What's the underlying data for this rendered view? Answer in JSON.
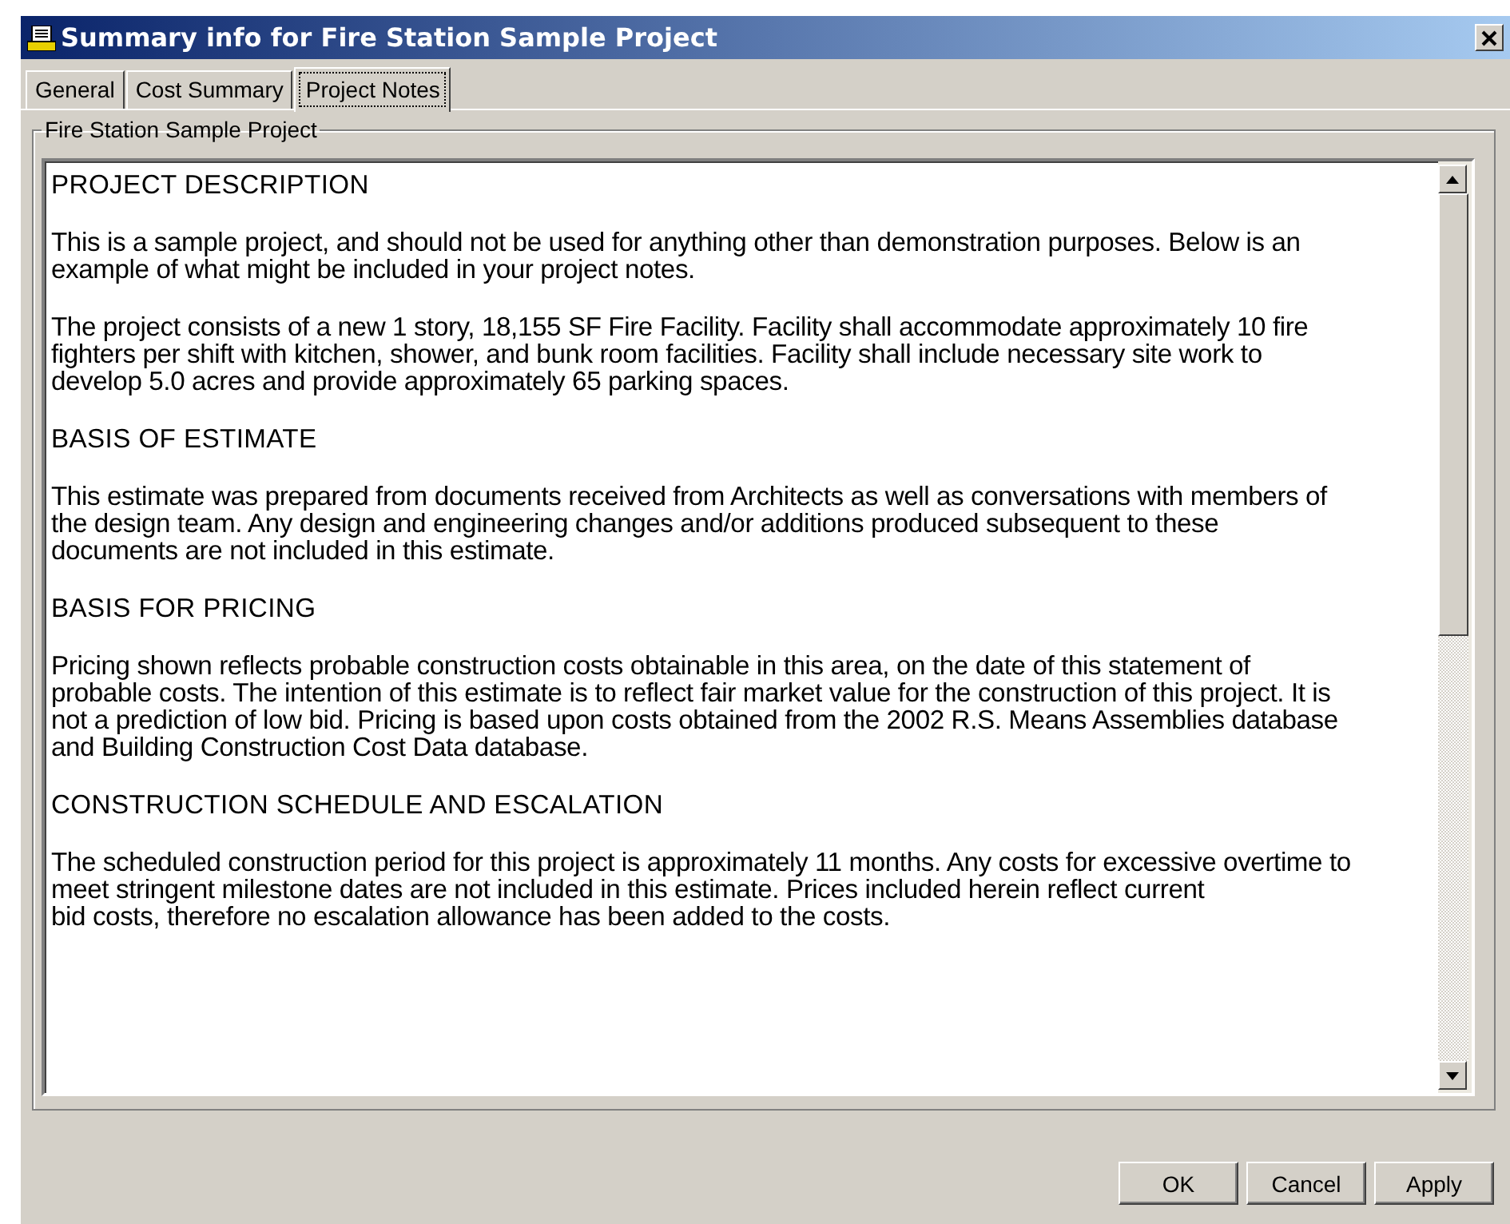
{
  "window": {
    "title": "Summary info for Fire Station Sample Project"
  },
  "tabs": [
    {
      "label": "General",
      "selected": false
    },
    {
      "label": "Cost Summary",
      "selected": false
    },
    {
      "label": "Project Notes",
      "selected": true
    }
  ],
  "group": {
    "label": "Fire Station Sample Project"
  },
  "notes": [
    {
      "kind": "heading",
      "text": "PROJECT DESCRIPTION"
    },
    {
      "kind": "body",
      "text": "This is a sample project, and should not be used for anything other than demonstration purposes.  Below is an\nexample of what might be included in your project notes."
    },
    {
      "kind": "body",
      "text": "The project consists of a new 1 story, 18,155 SF Fire Facility.  Facility shall accommodate approximately 10 fire\nfighters per shift with kitchen, shower, and bunk room facilities. Facility shall include necessary site work to\ndevelop 5.0 acres and provide approximately 65 parking spaces."
    },
    {
      "kind": "heading",
      "text": "BASIS OF ESTIMATE"
    },
    {
      "kind": "body",
      "text": "This estimate was prepared from documents received from Architects as well as conversations with members of\nthe design team.  Any design and engineering changes and/or additions produced subsequent to these\ndocuments are not included in this estimate."
    },
    {
      "kind": "heading",
      "text": "BASIS FOR PRICING"
    },
    {
      "kind": "body",
      "text": "Pricing shown reflects probable construction costs obtainable in this area, on the date of this statement of\nprobable costs.  The intention of this estimate is to reflect fair market value for the construction of this project. It is\nnot a prediction of low bid.  Pricing is based upon costs obtained from the 2002 R.S. Means Assemblies database\nand Building Construction Cost Data database."
    },
    {
      "kind": "heading",
      "text": "CONSTRUCTION SCHEDULE AND ESCALATION"
    },
    {
      "kind": "body",
      "text": "The scheduled construction period for this project is approximately 11 months. Any costs for excessive overtime to\nmeet stringent milestone dates are not included in this estimate. Prices included herein reflect current\nbid costs, therefore no escalation allowance has been added to the costs."
    }
  ],
  "buttons": [
    {
      "label": "OK"
    },
    {
      "label": "Cancel"
    },
    {
      "label": "Apply"
    }
  ]
}
